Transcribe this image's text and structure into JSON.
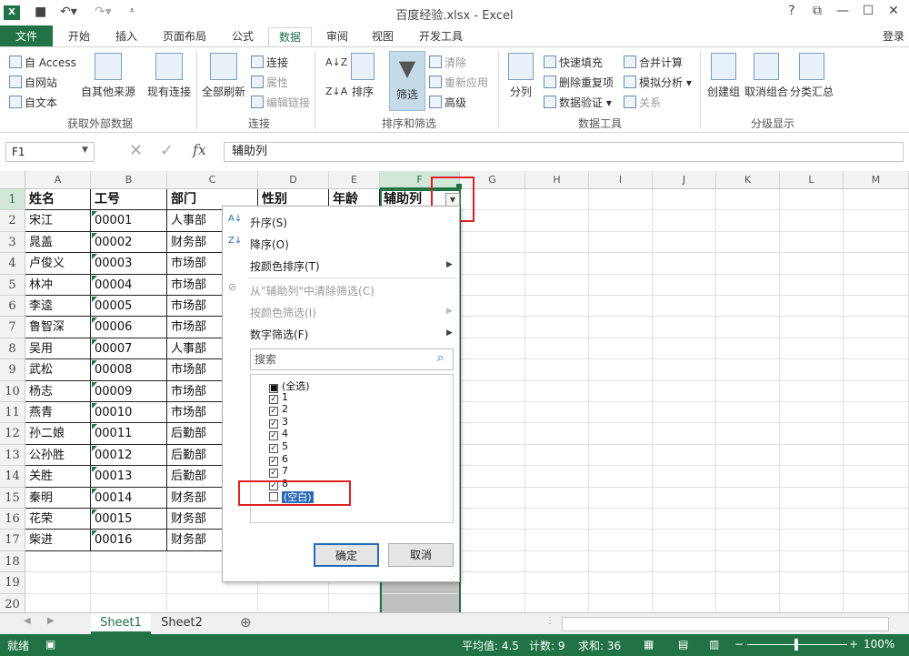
{
  "app": {
    "title": "百度经验.xlsx - Excel",
    "logo": "X",
    "login": "登录",
    "help": "?",
    "accent": "#217346"
  },
  "tabs": [
    "文件",
    "开始",
    "插入",
    "页面布局",
    "公式",
    "数据",
    "审阅",
    "视图",
    "开发工具"
  ],
  "ribbon": {
    "ext_data": {
      "access": "自 Access",
      "web": "自网站",
      "text": "自文本",
      "other": "自其他来源",
      "existing": "现有连接",
      "group": "获取外部数据"
    },
    "connections": {
      "refresh": "全部刷新",
      "conn": "连接",
      "props": "属性",
      "edit_links": "编辑链接",
      "group": "连接"
    },
    "sort_filter": {
      "sort": "排序",
      "filter": "筛选",
      "clear": "清除",
      "reapply": "重新应用",
      "advanced": "高级",
      "group": "排序和筛选"
    },
    "data_tools": {
      "split": "分列",
      "flash": "快速填充",
      "remove_dup": "删除重复项",
      "validation": "数据验证",
      "consolidate": "合并计算",
      "whatif": "模拟分析",
      "relations": "关系",
      "group": "数据工具"
    },
    "outline": {
      "group_btn": "创建组",
      "ungroup": "取消组合",
      "subtotal": "分类汇总",
      "group": "分级显示"
    }
  },
  "formula_bar": {
    "name_box": "F1",
    "fx": "fx",
    "value": "辅助列"
  },
  "columns": [
    "A",
    "B",
    "C",
    "D",
    "E",
    "F",
    "G",
    "H",
    "I",
    "J",
    "K",
    "L",
    "M"
  ],
  "rows": [
    "1",
    "2",
    "3",
    "4",
    "5",
    "6",
    "7",
    "8",
    "9",
    "10",
    "11",
    "12",
    "13",
    "14",
    "15",
    "16",
    "17",
    "18",
    "19",
    "20"
  ],
  "table": {
    "headers": [
      "姓名",
      "工号",
      "部门",
      "性别",
      "年龄",
      "辅助列"
    ],
    "data": [
      [
        "宋江",
        "00001",
        "人事部"
      ],
      [
        "晁盖",
        "00002",
        "财务部"
      ],
      [
        "卢俊义",
        "00003",
        "市场部"
      ],
      [
        "林冲",
        "00004",
        "市场部"
      ],
      [
        "李逵",
        "00005",
        "市场部"
      ],
      [
        "鲁智深",
        "00006",
        "市场部"
      ],
      [
        "吴用",
        "00007",
        "人事部"
      ],
      [
        "武松",
        "00008",
        "市场部"
      ],
      [
        "杨志",
        "00009",
        "市场部"
      ],
      [
        "燕青",
        "00010",
        "市场部"
      ],
      [
        "孙二娘",
        "00011",
        "后勤部"
      ],
      [
        "公孙胜",
        "00012",
        "后勤部"
      ],
      [
        "关胜",
        "00013",
        "后勤部"
      ],
      [
        "秦明",
        "00014",
        "财务部"
      ],
      [
        "花荣",
        "00015",
        "财务部"
      ],
      [
        "柴进",
        "00016",
        "财务部"
      ]
    ]
  },
  "filter_menu": {
    "sort_asc": "升序(S)",
    "sort_desc": "降序(O)",
    "sort_color": "按颜色排序(T)",
    "clear_filter": "从\"辅助列\"中清除筛选(C)",
    "filter_color": "按颜色筛选(I)",
    "num_filter": "数字筛选(F)",
    "search_placeholder": "搜索",
    "items": [
      {
        "label": "(全选)",
        "checked": "partial"
      },
      {
        "label": "1",
        "checked": true
      },
      {
        "label": "2",
        "checked": true
      },
      {
        "label": "3",
        "checked": true
      },
      {
        "label": "4",
        "checked": true
      },
      {
        "label": "5",
        "checked": true
      },
      {
        "label": "6",
        "checked": true
      },
      {
        "label": "7",
        "checked": true
      },
      {
        "label": "8",
        "checked": true
      },
      {
        "label": "(空白)",
        "checked": false
      }
    ],
    "ok": "确定",
    "cancel": "取消"
  },
  "sheets": [
    "Sheet1",
    "Sheet2"
  ],
  "status": {
    "ready": "就绪",
    "avg": "平均值: 4.5",
    "count": "计数: 9",
    "sum": "求和: 36",
    "zoom": "100%"
  }
}
